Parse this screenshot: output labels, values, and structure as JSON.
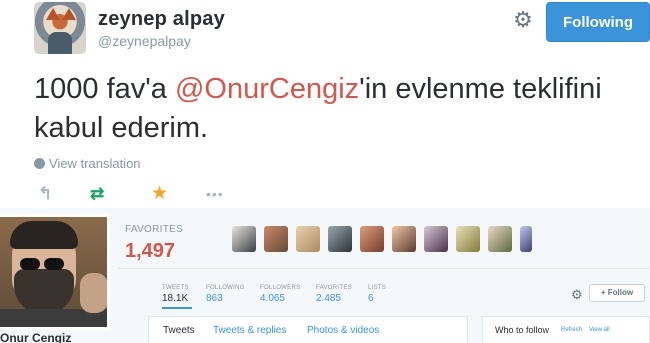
{
  "tweet": {
    "user_name": "zeynep alpay",
    "user_handle": "@zeynepalpay",
    "follow_label": "Following",
    "text_before": "1000 fav'a ",
    "mention": "@OnurCengiz",
    "text_after": "'in evlenme teklifini kabul ederim.",
    "view_translation": "View translation",
    "icons": {
      "settings": "gear-icon",
      "reply": "reply-icon",
      "retweet": "retweet-icon",
      "favorite": "star-icon",
      "more": "more-icon",
      "translation": "globe-icon"
    },
    "colors": {
      "mention": "#d0584e",
      "follow_button": "#3b94d9",
      "retweet": "#19a466",
      "favorite": "#f5a623"
    }
  },
  "profile": {
    "name": "Onur Cengiz",
    "favorites_label": "FAVORITES",
    "favorites_count": "1,497",
    "stats": [
      {
        "label": "TWEETS",
        "value": "18.1K"
      },
      {
        "label": "FOLLOWING",
        "value": "863"
      },
      {
        "label": "FOLLOWERS",
        "value": "4.065"
      },
      {
        "label": "FAVORITES",
        "value": "2.485"
      },
      {
        "label": "LISTS",
        "value": "6"
      }
    ],
    "follow_label": "Follow",
    "tabs": [
      "Tweets",
      "Tweets & replies",
      "Photos & videos"
    ],
    "who_to_follow": "Who to follow",
    "refresh": "Refresh",
    "view_all": "View all"
  }
}
